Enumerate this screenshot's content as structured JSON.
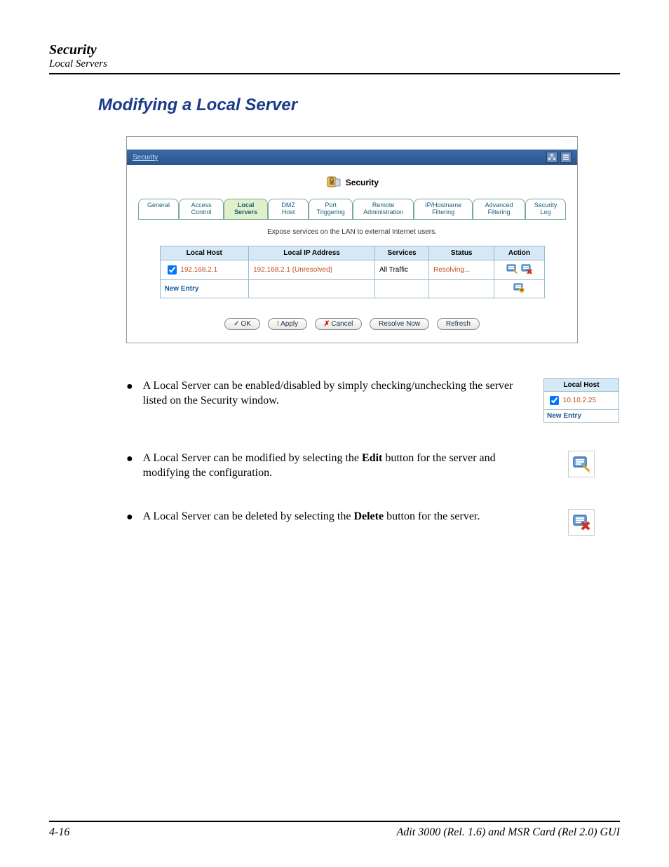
{
  "header": {
    "title": "Security",
    "subtitle": "Local Servers"
  },
  "section_title": "Modifying a Local Server",
  "screenshot": {
    "breadcrumb": "Security",
    "panel_title": "Security",
    "tabs": [
      "General",
      "Access Control",
      "Local Servers",
      "DMZ Host",
      "Port Triggering",
      "Remote Administration",
      "IP/Hostname Filtering",
      "Advanced Filtering",
      "Security Log"
    ],
    "active_tab_index": 2,
    "description": "Expose services on the LAN to external Internet users.",
    "table": {
      "headers": [
        "Local Host",
        "Local IP Address",
        "Services",
        "Status",
        "Action"
      ],
      "rows": [
        {
          "checked": true,
          "host": "192.168.2.1",
          "ip": "192.168.2.1 (Unresolved)",
          "services": "All Traffic",
          "status": "Resolving..."
        }
      ],
      "new_entry": "New Entry"
    },
    "buttons": {
      "ok": "OK",
      "apply": "Apply",
      "cancel": "Cancel",
      "resolve": "Resolve Now",
      "refresh": "Refresh"
    }
  },
  "bullets": {
    "b1_pre": "A Local Server can be enabled/disabled by simply checking/unchecking the server listed on the Security window.",
    "b2_pre": "A Local Server can be modified by selecting the ",
    "b2_bold": "Edit",
    "b2_post": " button for the server and modifying the configuration.",
    "b3_pre": "A Local Server can be deleted by selecting the ",
    "b3_bold": "Delete",
    "b3_post": " button for the server."
  },
  "mini": {
    "header": "Local Host",
    "value": "10.10.2.25",
    "new_entry": "New Entry"
  },
  "footer": {
    "page": "4-16",
    "product": "Adit 3000 (Rel. 1.6) and MSR Card (Rel 2.0) GUI"
  }
}
